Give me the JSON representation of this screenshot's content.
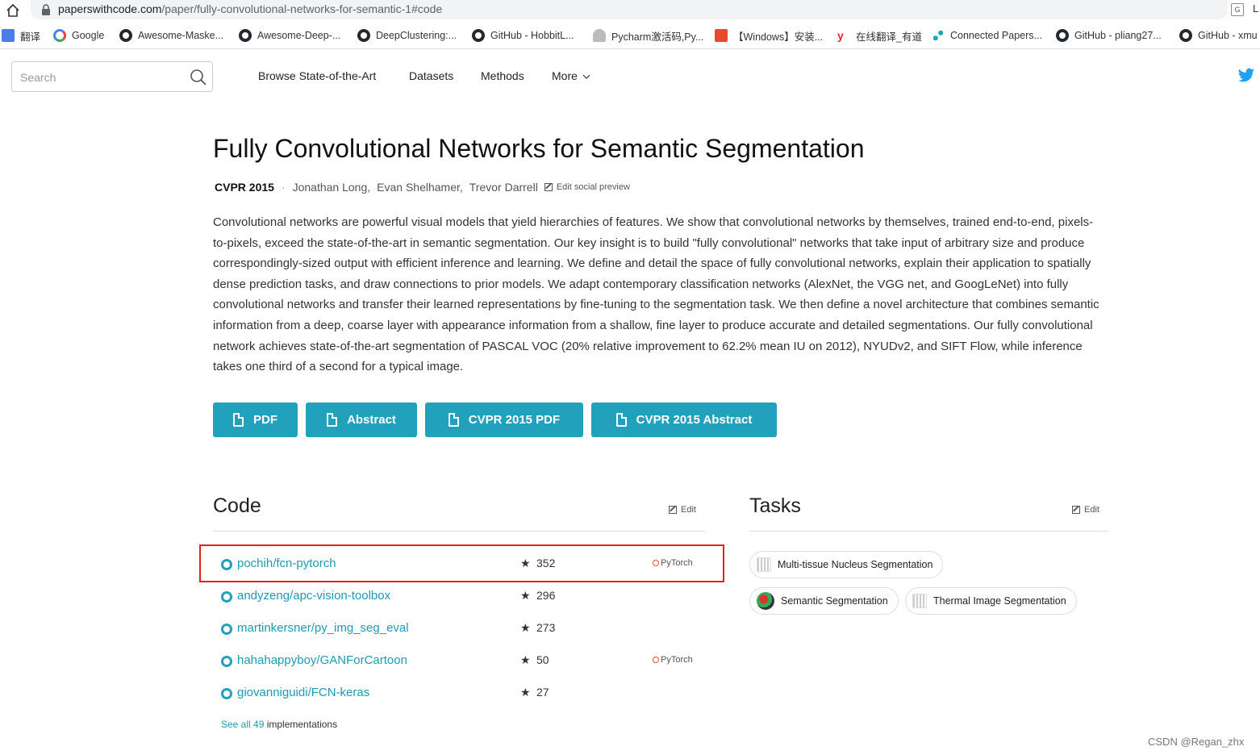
{
  "browser": {
    "url_main": "paperswithcode.com",
    "url_path": "/paper/fully-convolutional-networks-for-semantic-1#code",
    "cut_char": "L",
    "bookmarks": [
      {
        "label": "翻译",
        "icon": "translate-icon"
      },
      {
        "label": "Google",
        "icon": "google-icon"
      },
      {
        "label": "Awesome-Maske...",
        "icon": "github-icon"
      },
      {
        "label": "Awesome-Deep-...",
        "icon": "github-icon"
      },
      {
        "label": "DeepClustering:...",
        "icon": "github-icon"
      },
      {
        "label": "GitHub - HobbitL...",
        "icon": "github-icon"
      },
      {
        "label": "Pycharm激活码,Py...",
        "icon": "pycharm-icon"
      },
      {
        "label": "【Windows】安装...",
        "icon": "csdn-icon"
      },
      {
        "label": "在线翻译_有道",
        "icon": "youdao-icon"
      },
      {
        "label": "Connected Papers...",
        "icon": "connected-papers-icon"
      },
      {
        "label": "GitHub - pliang27...",
        "icon": "github-icon"
      },
      {
        "label": "GitHub - xmu",
        "icon": "github-icon"
      }
    ]
  },
  "nav": {
    "search_placeholder": "Search",
    "items": [
      "Browse State-of-the-Art",
      "Datasets",
      "Methods",
      "More"
    ]
  },
  "paper": {
    "title": "Fully Convolutional Networks for Semantic Segmentation",
    "venue": "CVPR 2015",
    "separator": "·",
    "authors": [
      "Jonathan Long,",
      "Evan Shelhamer,",
      "Trevor Darrell"
    ],
    "edit_preview": "Edit social preview",
    "abstract": "Convolutional networks are powerful visual models that yield hierarchies of features. We show that convolutional networks by themselves, trained end-to-end, pixels-to-pixels, exceed the state-of-the-art in semantic segmentation. Our key insight is to build \"fully convolutional\" networks that take input of arbitrary size and produce correspondingly-sized output with efficient inference and learning. We define and detail the space of fully convolutional networks, explain their application to spatially dense prediction tasks, and draw connections to prior models. We adapt contemporary classification networks (AlexNet, the VGG net, and GoogLeNet) into fully convolutional networks and transfer their learned representations by fine-tuning to the segmentation task. We then define a novel architecture that combines semantic information from a deep, coarse layer with appearance information from a shallow, fine layer to produce accurate and detailed segmentations. Our fully convolutional network achieves state-of-the-art segmentation of PASCAL VOC (20% relative improvement to 62.2% mean IU on 2012), NYUDv2, and SIFT Flow, while inference takes one third of a second for a typical image.",
    "buttons": [
      "PDF",
      "Abstract",
      "CVPR 2015 PDF",
      "CVPR 2015 Abstract"
    ],
    "button_color": "#21a1bb"
  },
  "code": {
    "title": "Code",
    "edit": "Edit",
    "repos": [
      {
        "name": "pochih/fcn-pytorch",
        "stars": "352",
        "framework": "PyTorch"
      },
      {
        "name": "andyzeng/apc-vision-toolbox",
        "stars": "296",
        "framework": ""
      },
      {
        "name": "martinkersner/py_img_seg_eval",
        "stars": "273",
        "framework": ""
      },
      {
        "name": "hahahappyboy/GANForCartoon",
        "stars": "50",
        "framework": "PyTorch"
      },
      {
        "name": "giovanniguidi/FCN-keras",
        "stars": "27",
        "framework": ""
      }
    ],
    "see_all_link": "See all 49",
    "see_all_suffix": " implementations",
    "highlight_color": "#e0241b"
  },
  "tasks": {
    "title": "Tasks",
    "edit": "Edit",
    "items": [
      {
        "label": "Multi-tissue Nucleus Segmentation",
        "icon": "task-bars-icon"
      },
      {
        "label": "Semantic Segmentation",
        "icon": "task-image-icon"
      },
      {
        "label": "Thermal Image Segmentation",
        "icon": "task-bars-icon"
      }
    ]
  },
  "watermark": "CSDN @Regan_zhx"
}
